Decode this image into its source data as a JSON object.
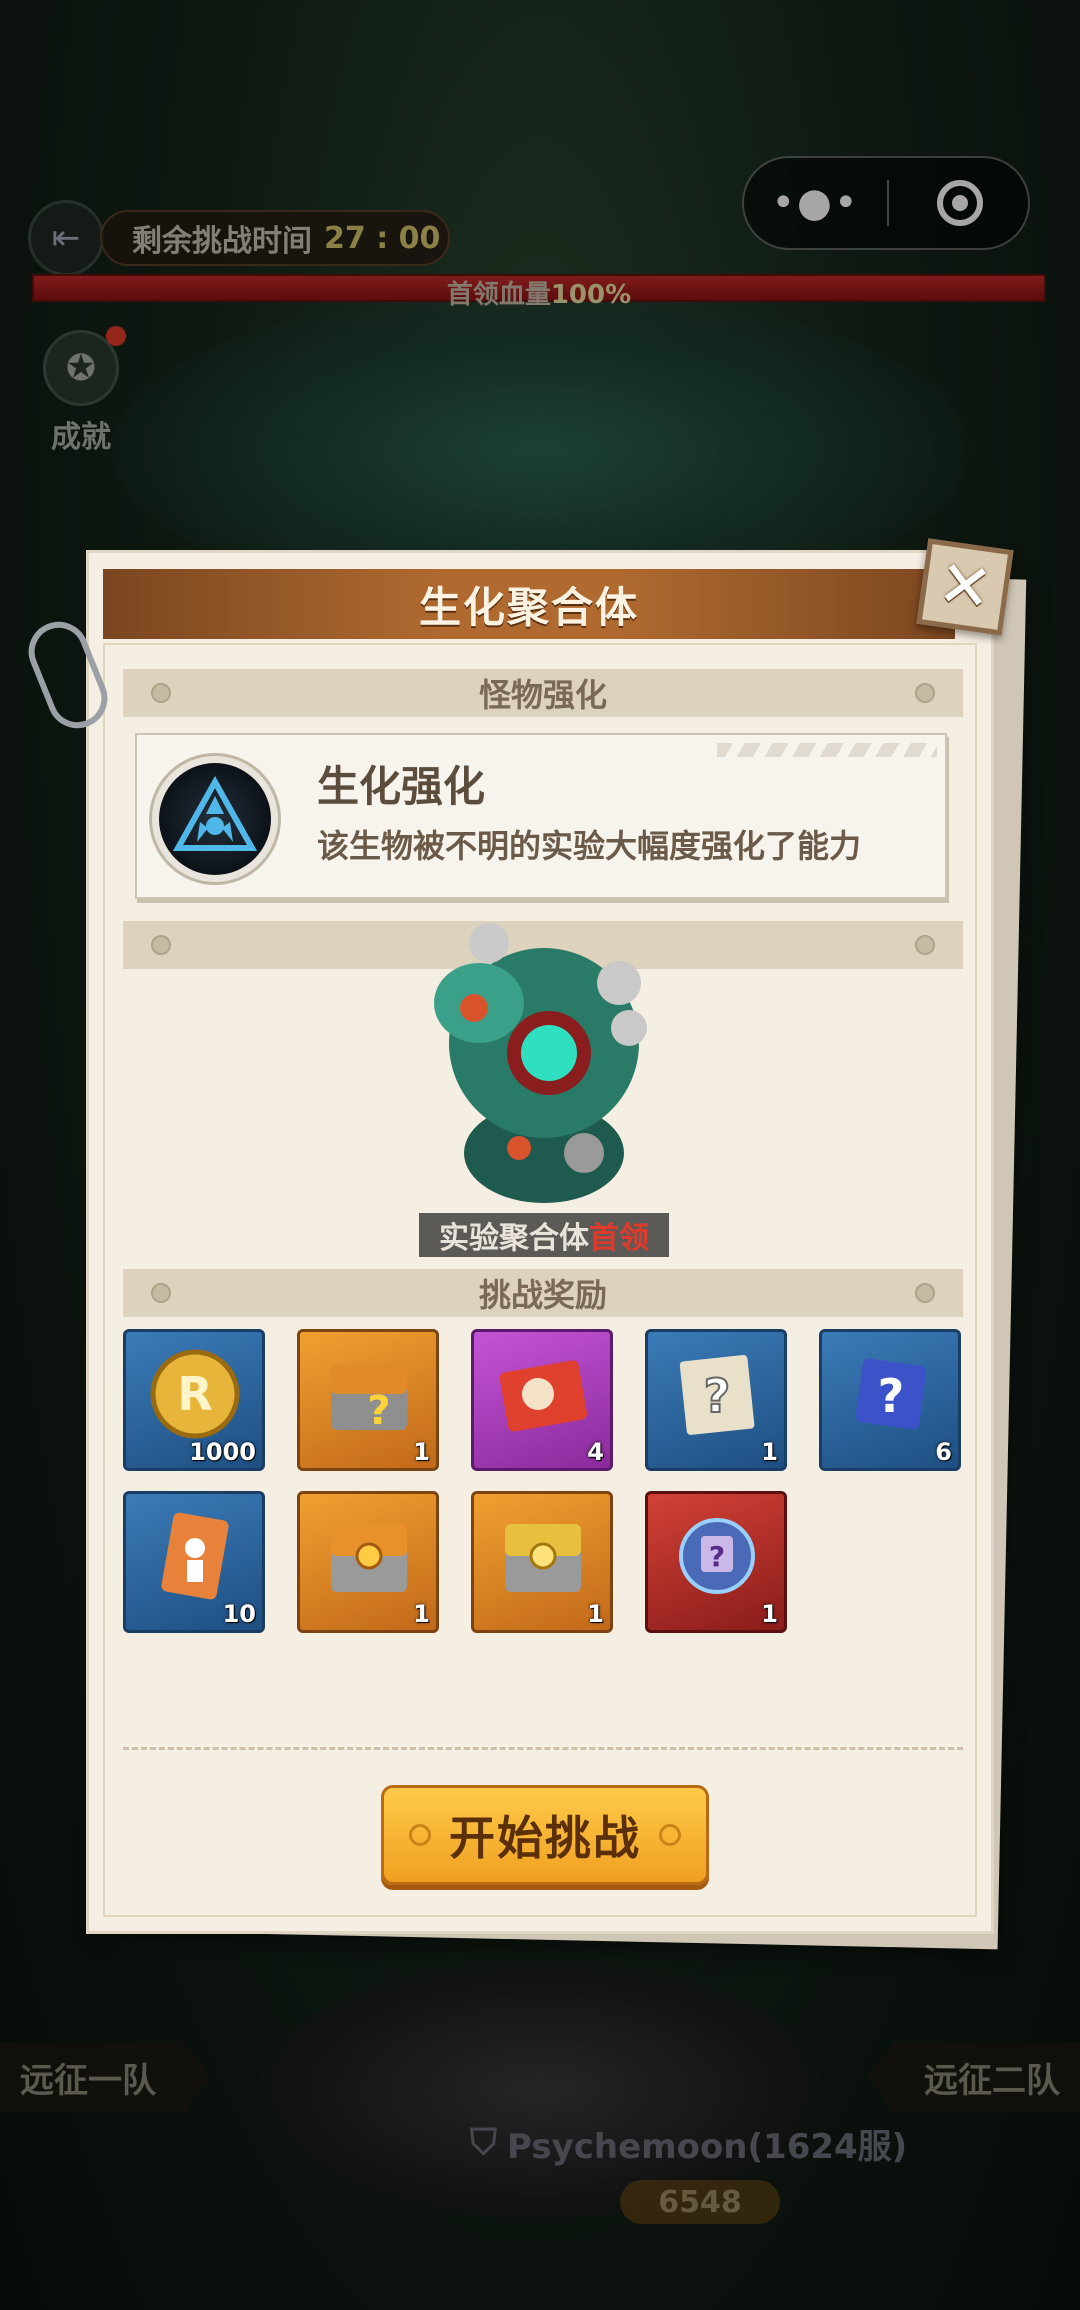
{
  "hud": {
    "timer_label": "剩余挑战时间",
    "timer_value": "27 : 00",
    "boss_hp_label": "首领血量",
    "boss_hp_value": "100%",
    "boss_hp_fraction": 1.0,
    "achievement_label": "成就"
  },
  "capsule": {
    "more_icon": "more-dots-icon",
    "close_icon": "close-mini-program-icon"
  },
  "dialog": {
    "title": "生化聚合体",
    "close_icon": "close-x-icon",
    "section_monster": "怪物强化",
    "skill": {
      "name": "生化强化",
      "description": "该生物被不明的实验大幅度强化了能力",
      "icon": "biohazard-icon"
    },
    "boss": {
      "label_main": "实验聚合体",
      "label_highlight": "首领"
    },
    "section_rewards": "挑战奖励",
    "rewards": [
      {
        "icon": "gold-coin-icon",
        "qty": "1000",
        "color": "blue"
      },
      {
        "icon": "mystery-chest-icon",
        "qty": "1",
        "color": "orange"
      },
      {
        "icon": "ticket-card-icon",
        "qty": "4",
        "color": "purple"
      },
      {
        "icon": "mystery-scroll-icon",
        "qty": "1",
        "color": "blue"
      },
      {
        "icon": "mystery-cube-icon",
        "qty": "6",
        "color": "blue"
      },
      {
        "icon": "hero-card-icon",
        "qty": "10",
        "color": "blue"
      },
      {
        "icon": "orange-chest-icon",
        "qty": "1",
        "color": "orange"
      },
      {
        "icon": "gold-chest-icon",
        "qty": "1",
        "color": "orange"
      },
      {
        "icon": "mystery-gear-icon",
        "qty": "1",
        "color": "red"
      }
    ],
    "start_button": "开始挑战"
  },
  "bottom": {
    "team_left": "远征一队",
    "team_right": "远征二队",
    "player_name": "Psychemoon(1624服)",
    "power": "6548"
  },
  "colors": {
    "title_bar": "#b06a30",
    "button": "#f0a020",
    "hp_bar": "#c42b2b"
  }
}
